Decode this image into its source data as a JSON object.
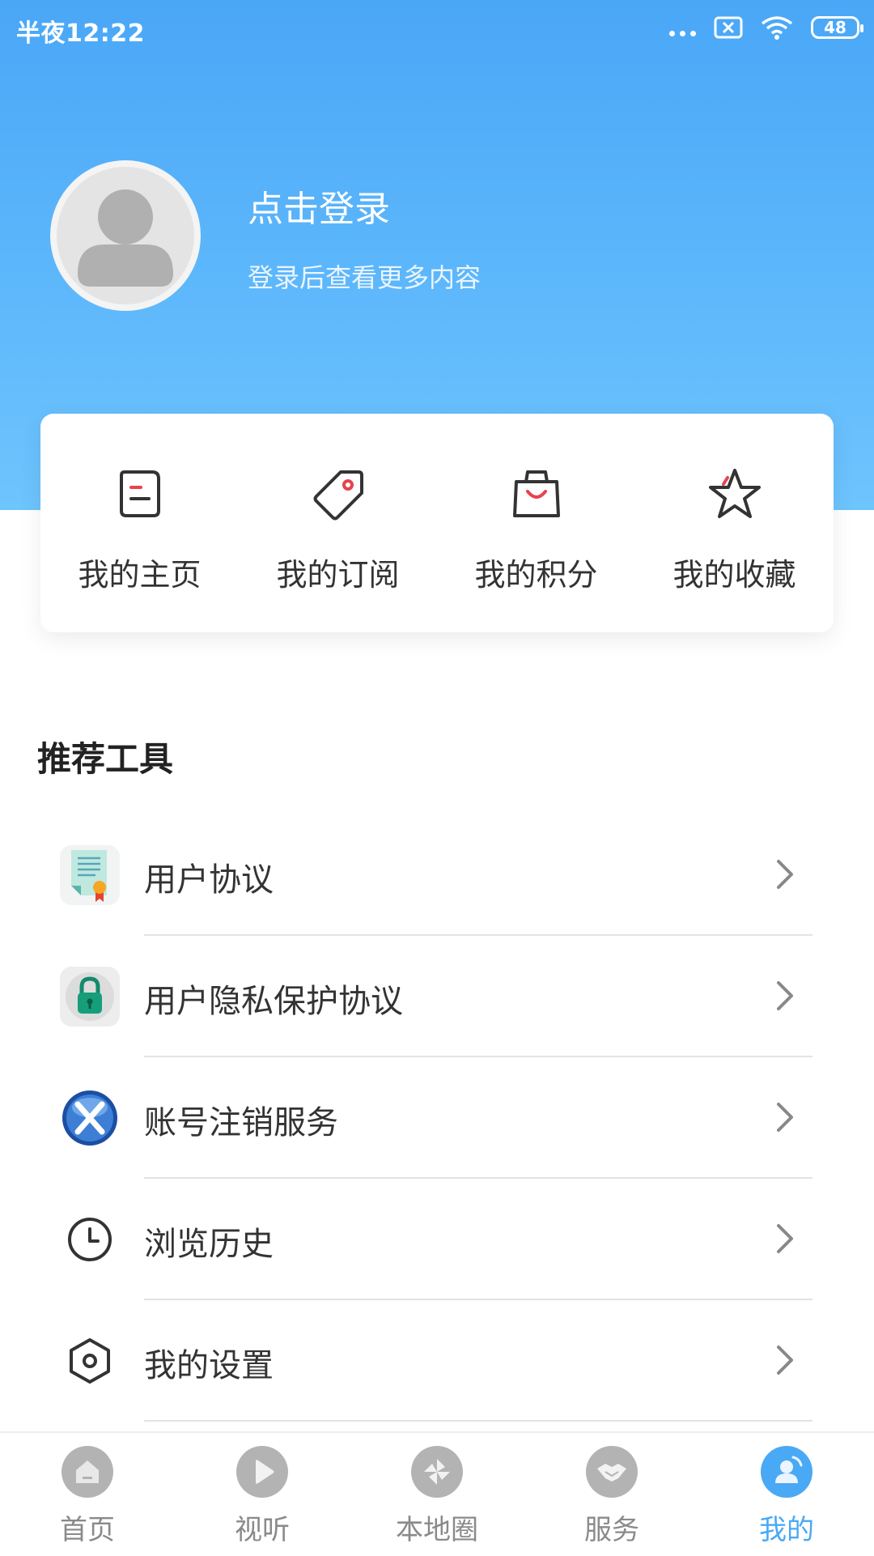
{
  "status_bar": {
    "time": "半夜12:22",
    "battery": "48",
    "icons": [
      "more-dots-icon",
      "sim-blocked-icon",
      "wifi-icon",
      "battery-icon"
    ]
  },
  "profile": {
    "login_title": "点击登录",
    "login_subtitle": "登录后查看更多内容",
    "avatar_icon": "default-avatar-icon"
  },
  "quick_actions": [
    {
      "label": "我的主页",
      "icon": "homepage-icon"
    },
    {
      "label": "我的订阅",
      "icon": "tag-icon"
    },
    {
      "label": "我的积分",
      "icon": "shopping-bag-icon"
    },
    {
      "label": "我的收藏",
      "icon": "star-icon"
    }
  ],
  "tools": {
    "title": "推荐工具",
    "items": [
      {
        "label": "用户协议",
        "icon": "certificate-icon"
      },
      {
        "label": "用户隐私保护协议",
        "icon": "lock-icon"
      },
      {
        "label": "账号注销服务",
        "icon": "x-circle-icon"
      },
      {
        "label": "浏览历史",
        "icon": "clock-icon"
      },
      {
        "label": "我的设置",
        "icon": "settings-hex-icon"
      }
    ]
  },
  "bottom_nav": [
    {
      "label": "首页",
      "icon": "home-icon",
      "active": false
    },
    {
      "label": "视听",
      "icon": "play-icon",
      "active": false
    },
    {
      "label": "本地圈",
      "icon": "pinwheel-icon",
      "active": false
    },
    {
      "label": "服务",
      "icon": "handshake-icon",
      "active": false
    },
    {
      "label": "我的",
      "icon": "user-icon",
      "active": true
    }
  ],
  "colors": {
    "header_top": "#4aa7f7",
    "header_bottom": "#6ec4fd",
    "accent": "#4aa9f5",
    "accent_red": "#e8434e",
    "inactive": "#b3b3b3"
  }
}
